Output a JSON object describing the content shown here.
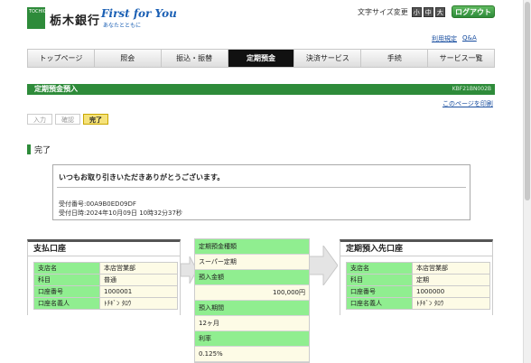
{
  "header": {
    "logo_text": "TOCHIGIN",
    "bank_name": "栃木銀行",
    "slogan": "First for You",
    "slogan_sub": "あなたとともに",
    "font_size_label": "文字サイズ変更",
    "font_sizes": [
      "小",
      "中",
      "大"
    ],
    "logout_label": "ログアウト",
    "links": [
      "利用規定",
      "Q&A"
    ]
  },
  "nav": {
    "tabs": [
      "トップページ",
      "照会",
      "振込・振替",
      "定期預金",
      "決済サービス",
      "手続",
      "サービス一覧"
    ],
    "active_index": 3
  },
  "title": {
    "text": "定期預金預入",
    "code": "KBF21BN002B",
    "print_link": "このページを印刷"
  },
  "steps": [
    "入力",
    "確認",
    "完了"
  ],
  "section_heading": "完了",
  "message": {
    "thanks": "いつもお取り引きいただきありがとうございます。",
    "receipt_no": "受付番号:00A9B0ED09DF",
    "receipt_date": "受付日時:2024年10月09日 10時32分37秒"
  },
  "from_account": {
    "title": "支払口座",
    "rows": [
      {
        "k": "支店名",
        "v": "本店営業部"
      },
      {
        "k": "科目",
        "v": "普通"
      },
      {
        "k": "口座番号",
        "v": "1000001"
      },
      {
        "k": "口座名義人",
        "v": "ﾄﾁｷﾞﾝ ﾀﾛｳ"
      }
    ]
  },
  "deposit": {
    "rows": [
      {
        "k": "定期預金種類",
        "v": "スーパー定期"
      },
      {
        "k": "預入金額",
        "v": "100,000円"
      },
      {
        "k": "預入期間",
        "v": "12ヶ月"
      },
      {
        "k": "利率",
        "v": "0.125%"
      }
    ]
  },
  "to_account": {
    "title": "定期預入先口座",
    "rows": [
      {
        "k": "支店名",
        "v": "本店営業部"
      },
      {
        "k": "科目",
        "v": "定期"
      },
      {
        "k": "口座番号",
        "v": "1000000"
      },
      {
        "k": "口座名義人",
        "v": "ﾄﾁｷﾞﾝ ﾀﾛｳ"
      }
    ]
  }
}
